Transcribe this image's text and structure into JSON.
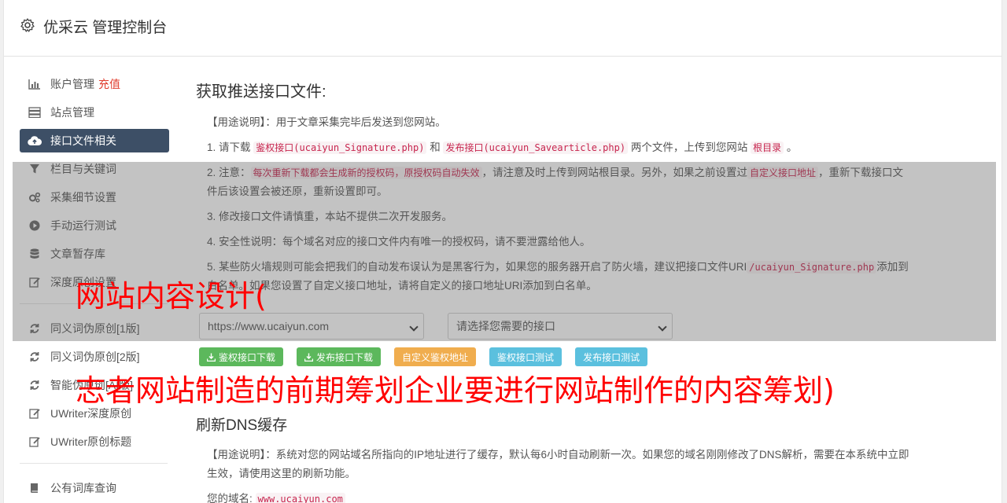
{
  "header": {
    "title": "优采云 管理控制台",
    "icon": "gear-icon"
  },
  "sidebar": {
    "items": [
      {
        "label": "账户管理",
        "badge": "充值",
        "icon": "bar-chart-icon"
      },
      {
        "label": "站点管理",
        "icon": "server-icon"
      },
      {
        "label": "接口文件相关",
        "icon": "cloud-upload-icon",
        "active": true
      },
      {
        "label": "栏目与关键词",
        "icon": "filter-icon"
      },
      {
        "label": "采集细节设置",
        "icon": "cogs-icon"
      },
      {
        "label": "手动运行测试",
        "icon": "play-circle-icon"
      },
      {
        "label": "文章暂存库",
        "icon": "database-icon"
      },
      {
        "label": "深度原创设置",
        "icon": "edit-icon"
      }
    ],
    "items2": [
      {
        "label": "同义词伪原创[1版]",
        "icon": "refresh-icon"
      },
      {
        "label": "同义词伪原创[2版]",
        "icon": "refresh-icon"
      },
      {
        "label": "智能伪原创[AI版]",
        "icon": "refresh-icon"
      },
      {
        "label": "UWriter深度原创",
        "icon": "edit-icon"
      },
      {
        "label": "UWriter原创标题",
        "icon": "edit-icon"
      }
    ],
    "items3": [
      {
        "label": "公有词库查询",
        "icon": "book-icon"
      }
    ]
  },
  "main": {
    "section1_title": "获取推送接口文件:",
    "usage_label": "【用途说明】",
    "usage_text": "：用于文章采集完毕后发送到您网站。",
    "p1_a": "1. 请下载 ",
    "p1_code1": "鉴权接口(ucaiyun_Signature.php)",
    "p1_b": " 和 ",
    "p1_code2": "发布接口(ucaiyun_Savearticle.php)",
    "p1_c": " 两个文件，上传到您网站 ",
    "p1_code3": "根目录",
    "p1_d": " 。",
    "p2_a": "2. 注意：",
    "p2_code1": "每次重新下载都会生成新的授权码，原授权码自动失效",
    "p2_b": "，请注意及时上传到网站根目录。另外，如果之前设置过",
    "p2_code2": "自定义接口地址",
    "p2_c": "，重新下载接口文件后该设置会被还原，重新设置即可。",
    "p3": "3. 修改接口文件请慎重，本站不提供二次开发服务。",
    "p4": "4. 安全性说明：每个域名对应的接口文件内有唯一的授权码，请不要泄露给他人。",
    "p5_a": "5. 某些防火墙规则可能会把我们的自动发布误认为是黑客行为，如果您的服务器开启了防火墙，建议把接口文件URI",
    "p5_code": "/ucaiyun_Signature.php",
    "p5_b": "添加到白名单。如果您设置了自定义接口地址，请将自定义的接口地址URI添加到白名单。",
    "select_site": "https://www.ucaiyun.com",
    "select_api": "请选择您需要的接口",
    "btn_sig": "鉴权接口下载",
    "btn_pub": "发布接口下载",
    "btn_custom": "自定义鉴权地址",
    "btn_sig_test": "鉴权接口测试",
    "btn_pub_test": "发布接口测试",
    "section2_title": "刷新DNS缓存",
    "dns_usage_label": "【用途说明】",
    "dns_usage_text": "：系统对您的网站域名所指向的IP地址进行了缓存，默认每6小时自动刷新一次。如果您的域名刚刚修改了DNS解析，需要在本系统中立即生效，请使用这里的刷新功能。",
    "domain_label": "您的域名:",
    "domain_value": "www.ucaiyun.com"
  },
  "overlay_text": {
    "line1": "网站内容设计(",
    "line2": "志者网站制造的前期筹划企业要进行网站制作的内容筹划)"
  },
  "colors": {
    "active_nav": "#3d4f66",
    "green": "#5cb85c",
    "orange": "#f0ad4e",
    "blue": "#5bc0de",
    "red_text": "#ff0000",
    "badge": "#e03c2d"
  }
}
